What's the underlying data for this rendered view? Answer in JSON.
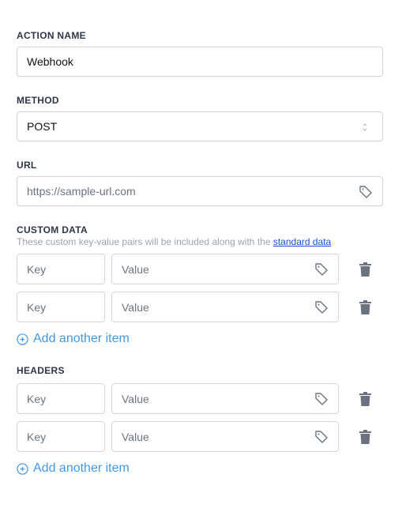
{
  "action_name": {
    "label": "ACTION NAME",
    "value": "Webhook"
  },
  "method": {
    "label": "METHOD",
    "value": "POST"
  },
  "url": {
    "label": "URL",
    "placeholder": "https://sample-url.com"
  },
  "custom_data": {
    "label": "CUSTOM DATA",
    "description": "These custom key-value pairs will be included along with the ",
    "link": "standard data",
    "rows": [
      {
        "key_placeholder": "Key",
        "value_placeholder": "Value"
      },
      {
        "key_placeholder": "Key",
        "value_placeholder": "Value"
      }
    ],
    "add_label": "Add another item"
  },
  "headers": {
    "label": "HEADERS",
    "rows": [
      {
        "key_placeholder": "Key",
        "value_placeholder": "Value"
      },
      {
        "key_placeholder": "Key",
        "value_placeholder": "Value"
      }
    ],
    "add_label": "Add another item"
  },
  "colors": {
    "accent": "#4299e1",
    "link": "#1d4ed8",
    "icon": "#6b7280"
  }
}
